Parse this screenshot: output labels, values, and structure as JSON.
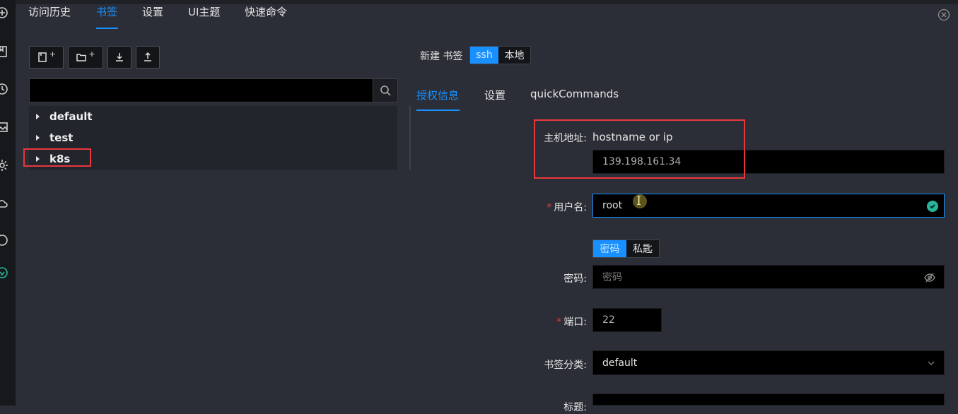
{
  "nav": {
    "tabs": [
      {
        "label": "访问历史",
        "active": false
      },
      {
        "label": "书签",
        "active": true
      },
      {
        "label": "设置",
        "active": false
      },
      {
        "label": "UI主题",
        "active": false
      },
      {
        "label": "快速命令",
        "active": false
      }
    ]
  },
  "toolbar": {
    "buttons": [
      "new-bookmark",
      "new-folder",
      "import",
      "export"
    ]
  },
  "search": {
    "value": "",
    "placeholder": ""
  },
  "tree": {
    "items": [
      {
        "label": "default"
      },
      {
        "label": "test"
      },
      {
        "label": "k8s"
      }
    ]
  },
  "form": {
    "title": "新建 书签",
    "type_options": [
      "ssh",
      "本地"
    ],
    "type_selected": "ssh",
    "subtabs": [
      {
        "label": "授权信息",
        "active": true
      },
      {
        "label": "设置",
        "active": false
      },
      {
        "label": "quickCommands",
        "active": false
      }
    ],
    "host": {
      "label": "主机地址:",
      "hint": "hostname or ip",
      "value": "139.198.161.34"
    },
    "username": {
      "label": "用户名:",
      "value": "root"
    },
    "auth_options": [
      "密码",
      "私匙"
    ],
    "auth_selected": "密码",
    "password": {
      "label": "密码:",
      "placeholder": "密码"
    },
    "port": {
      "label": "端口:",
      "value": "22"
    },
    "category": {
      "label": "书签分类:",
      "value": "default"
    },
    "title_field": {
      "label": "标题:"
    }
  },
  "colors": {
    "accent": "#1890ff",
    "highlight": "#e8383d",
    "success": "#28b59b"
  }
}
